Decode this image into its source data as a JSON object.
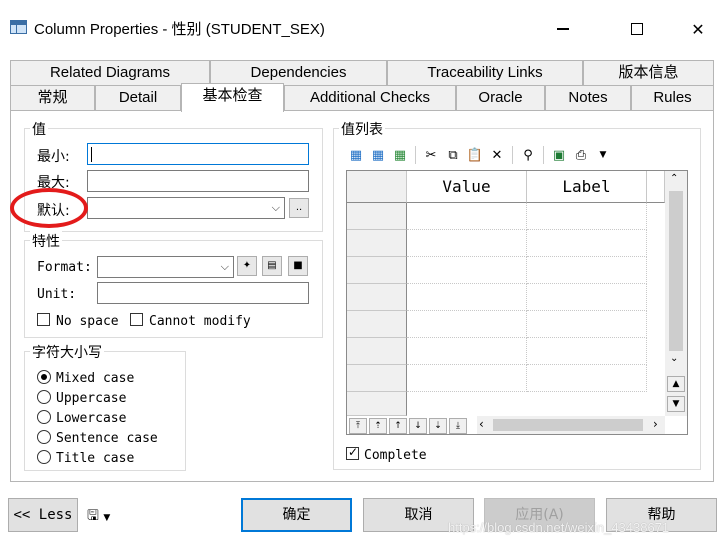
{
  "window": {
    "title": "Column Properties - 性别 (STUDENT_SEX)"
  },
  "tabs_row1": [
    "Related Diagrams",
    "Dependencies",
    "Traceability Links",
    "版本信息"
  ],
  "tabs_row2": [
    "常规",
    "Detail",
    "基本检查",
    "Additional Checks",
    "Oracle",
    "Notes",
    "Rules"
  ],
  "value_group": {
    "title": "值",
    "min_label": "最小:",
    "max_label": "最大:",
    "default_label": "默认:",
    "min_value": "",
    "max_value": "",
    "default_value": "",
    "more_button": ".."
  },
  "features_group": {
    "title": "特性",
    "format_label": "Format:",
    "unit_label": "Unit:",
    "format_value": "",
    "unit_value": "",
    "no_space_label": "No space",
    "cannot_modify_label": "Cannot modify"
  },
  "case_group": {
    "title": "字符大小写",
    "options": [
      "Mixed case",
      "Uppercase",
      "Lowercase",
      "Sentence case",
      "Title case"
    ],
    "selected": "Mixed case"
  },
  "value_list": {
    "title": "值列表",
    "columns": [
      "Value",
      "Label"
    ],
    "complete_label": "Complete",
    "complete_checked": true
  },
  "buttons": {
    "less": "<< Less",
    "ok": "确定",
    "cancel": "取消",
    "apply": "应用(A)",
    "help": "帮助"
  },
  "watermark": "https://blog.csdn.net/weixin_43438671",
  "colors": {
    "focus_border": "#0078d7",
    "annotation_circle": "#e31b1b"
  }
}
